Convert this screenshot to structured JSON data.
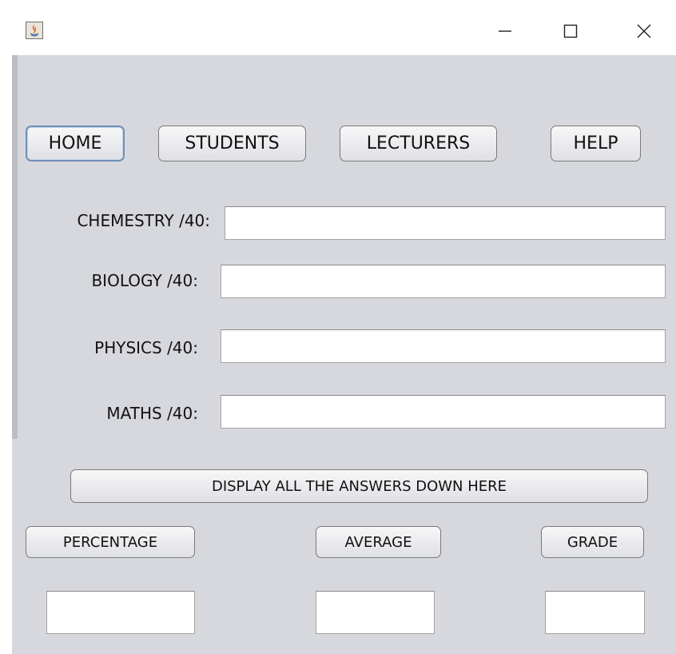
{
  "window": {
    "controls": {
      "minimize": "–",
      "maximize": "☐",
      "close": "✕"
    }
  },
  "nav": {
    "home": "HOME",
    "students": "STUDENTS",
    "lecturers": "LECTURERS",
    "help": "HELP"
  },
  "form": {
    "chemistry_label": "CHEMESTRY /40:",
    "biology_label": "BIOLOGY /40:",
    "physics_label": "PHYSICS /40:",
    "maths_label": "MATHS /40:",
    "chemistry_value": "",
    "biology_value": "",
    "physics_value": "",
    "maths_value": ""
  },
  "actions": {
    "display_all": "DISPLAY ALL THE ANSWERS DOWN HERE",
    "percentage": "PERCENTAGE",
    "average": "AVERAGE",
    "grade": "GRADE"
  },
  "results": {
    "percentage_value": "",
    "average_value": "",
    "grade_value": ""
  }
}
